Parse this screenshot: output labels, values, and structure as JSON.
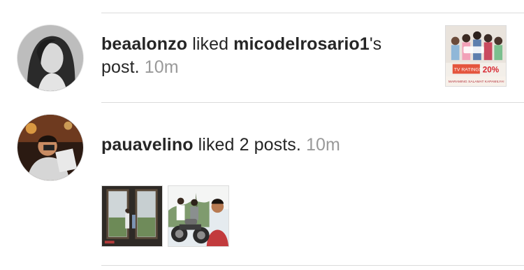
{
  "activity": [
    {
      "user": "beaalonzo",
      "verb": "liked",
      "target_user": "micodelrosario1",
      "target_suffix": "'s",
      "line2": "post.",
      "time": "10m",
      "avatar_icon": "user-avatar-photo",
      "thumbnail": {
        "text_lines": [
          "TV RATINGS",
          "20%",
          "MARAMING SALAMAT KAPAMILYA!"
        ],
        "accent": "#d8262f"
      }
    },
    {
      "user": "pauavelino",
      "action": "liked 2 posts.",
      "time": "10m",
      "avatar_icon": "user-avatar-photo",
      "thumbnails": [
        {
          "icon": "post-thumbnail-photo"
        },
        {
          "icon": "post-thumbnail-photo"
        }
      ]
    }
  ],
  "colors": {
    "text": "#262626",
    "muted": "#999999",
    "divider": "#dbdbdb"
  }
}
